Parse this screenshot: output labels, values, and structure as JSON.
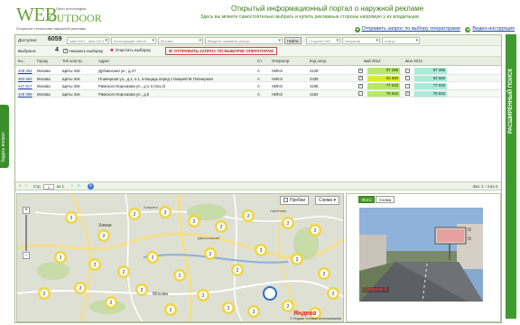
{
  "logo": {
    "web": "WEB",
    "outdoor": "OUTDOOR",
    "open": "Open technologies",
    "tagline": "Открытые технологии наружной рекламы"
  },
  "portal": {
    "title": "Открытый информационный портал о наружной рекламе",
    "subtitle": "Здесь вы можете самостоятельно выбрать и купить рекламные стороны напрямую у их владельцев"
  },
  "header_links": {
    "request": "Отправить запрос по выбору операторами",
    "video": "Видео-инструкция"
  },
  "side_tabs": {
    "left": "Задать вопрос",
    "right": "РАСШИРЕННЫЙ ПОИСК"
  },
  "filter": {
    "available_label": "Доступно:",
    "available_count": "6059",
    "period": "май 2014 - июн 2014",
    "construction": "Конструкции обычн",
    "city": "Москва",
    "street_placeholder": "Введите название улицы",
    "find_button": "Найти",
    "gid": "Сторона GID",
    "operator": "оператор",
    "status": "статус",
    "selected_label": "Выбрано:",
    "selected_count": "4",
    "show_selection": "показать выборку",
    "clear_selection": "Очистить выборку",
    "send_request": "ОТПРАВИТЬ ЗАПРОС ПО ВЫБОРКЕ ОПЕРАТОРАМ"
  },
  "table": {
    "headers": [
      "Ко...",
      "Город",
      "Тип констр.",
      "Адрес",
      "Ст.",
      "Оператор",
      "Код опер.",
      "май 2014",
      "июн 2014"
    ],
    "rows": [
      {
        "code": "449 262",
        "city": "Москва",
        "type": "Щиты 3х6",
        "address": "Дубнинская ул., д.47",
        "side": "А",
        "operator": "НИКЭ",
        "op_code": "4129",
        "may": "97 286",
        "jun": "97 286",
        "may_checked": true,
        "jun_checked": false
      },
      {
        "code": "393 592",
        "city": "Москва",
        "type": "Щиты 3х6",
        "address": "Планерная ул., д.1, к.1, площадь перед станцией М.Планерная",
        "side": "А",
        "operator": "НИКЭ",
        "op_code": "2339",
        "may": "94 660",
        "jun": "94 660",
        "may_checked": true,
        "jun_checked": false
      },
      {
        "code": "447 917",
        "city": "Москва",
        "type": "Щиты 3х6",
        "address": "Римского-Корсакова ул., д.1-3 (поз.2)",
        "side": "А",
        "operator": "НИКЭ",
        "op_code": "4196",
        "may": "77 033",
        "jun": "77 033",
        "may_checked": true,
        "jun_checked": false
      },
      {
        "code": "449 399",
        "city": "Москва",
        "type": "Щиты 3х6",
        "address": "Римского-Корсакова ул., д.6",
        "side": "А",
        "operator": "НИКЭ",
        "op_code": "4184",
        "may": "76 642",
        "jun": "76 642",
        "may_checked": false,
        "jun_checked": true
      }
    ]
  },
  "pager": {
    "page_label": "Стр.",
    "page": "1",
    "of": "из 1",
    "summary": "Зап. 1 - 4 из 4"
  },
  "map": {
    "probki": "Пробки",
    "scheme": "Схема",
    "place_labels": [
      "Химки",
      "Москва",
      "Дмитровский",
      "Свиблово",
      "Ховрино"
    ],
    "copyright": "© Яндекс  Условия использования",
    "yandex": "Яндекс",
    "cluster_labels": [
      "2",
      "2",
      "2",
      "3",
      "2",
      "2",
      "2",
      "2",
      "2",
      "2",
      "2",
      "2",
      "2",
      "2",
      "2",
      "2",
      "3",
      "2",
      "2",
      "2",
      "2",
      "2",
      "2",
      "2",
      "2",
      "2",
      "3",
      "2",
      "2",
      "2"
    ]
  },
  "photo": {
    "tab_photo": "Фото",
    "tab_scheme": "Схема",
    "caption": "Сторона А"
  },
  "colors": {
    "brand_green": "#3e9a2e",
    "may_cell": "#b6e86a",
    "may_cell_hi": "#d8f02a",
    "jun_cell": "#a8ecd8",
    "link_blue": "#1a3fa0",
    "cluster_yellow": "#f2d42a"
  }
}
